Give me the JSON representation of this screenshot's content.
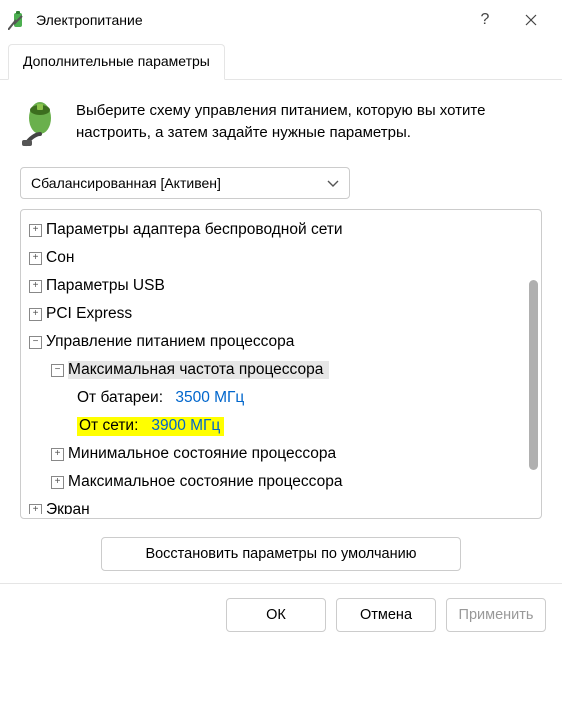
{
  "titlebar": {
    "title": "Электропитание",
    "help": "?",
    "close": "✕"
  },
  "tab": {
    "label": "Дополнительные параметры"
  },
  "intro": {
    "text": "Выберите схему управления питанием, которую вы хотите настроить, а затем задайте нужные параметры."
  },
  "plan": {
    "selected": "Сбалансированная [Активен]"
  },
  "tree": {
    "n0": "Параметры адаптера беспроводной сети",
    "n1": "Сон",
    "n2": "Параметры USB",
    "n3": "PCI Express",
    "n4": "Управление питанием процессора",
    "n4_0": "Максимальная частота процессора",
    "n4_0_a_label": "От батареи:",
    "n4_0_a_value": "3500 МГц",
    "n4_0_b_label": "От сети:",
    "n4_0_b_value": "3900 МГц",
    "n4_1": "Минимальное состояние процессора",
    "n4_2": "Максимальное состояние процессора",
    "n5": "Экран"
  },
  "restore": "Восстановить параметры по умолчанию",
  "footer": {
    "ok": "ОК",
    "cancel": "Отмена",
    "apply": "Применить"
  }
}
